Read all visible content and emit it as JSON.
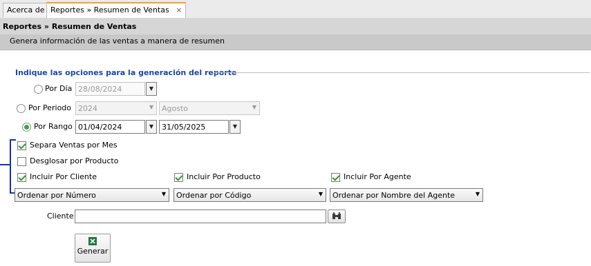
{
  "tabs": [
    {
      "label": "Acerca de",
      "active": false
    },
    {
      "label": "Reportes » Resumen de Ventas",
      "active": true,
      "close_icon": "×"
    }
  ],
  "header": {
    "title": "Reportes » Resumen de Ventas",
    "subtitle": "Genera información de las ventas a manera de resumen"
  },
  "options": {
    "group_label": "Indique las opciones para la generación del reporte",
    "por_dia": {
      "label": "Por Día",
      "value": "28/08/2024",
      "selected": false
    },
    "por_periodo": {
      "label": "Por Periodo",
      "year": "2024",
      "month": "Agosto",
      "selected": false
    },
    "por_rango": {
      "label": "Por Rango",
      "from": "01/04/2024",
      "to": "31/05/2025",
      "selected": true
    }
  },
  "checks": {
    "separa_mes": {
      "label": "Separa Ventas por Mes",
      "checked": true
    },
    "desglosar": {
      "label": "Desglosar por Producto",
      "checked": false
    },
    "incluir_cliente": {
      "label": "Incluir Por Cliente",
      "checked": true
    },
    "incluir_producto": {
      "label": "Incluir Por Producto",
      "checked": true
    },
    "incluir_agente": {
      "label": "Incluir Por Agente",
      "checked": true
    }
  },
  "orders": {
    "cliente": "Ordenar por Número",
    "producto": "Ordenar por Código",
    "agente": "Ordenar por Nombre del Agente"
  },
  "cliente": {
    "label": "Cliente",
    "value": ""
  },
  "generate_button": {
    "label": "Generar"
  },
  "colors": {
    "accent_tab": "#f0a030",
    "group_label": "#1a46a0",
    "check_green": "#2e9a2e",
    "annotation_blue": "#1a2fa5"
  },
  "icons": {
    "dropdown": "chevron-down-icon",
    "lookup": "binoculars-icon",
    "generate": "excel-icon"
  }
}
